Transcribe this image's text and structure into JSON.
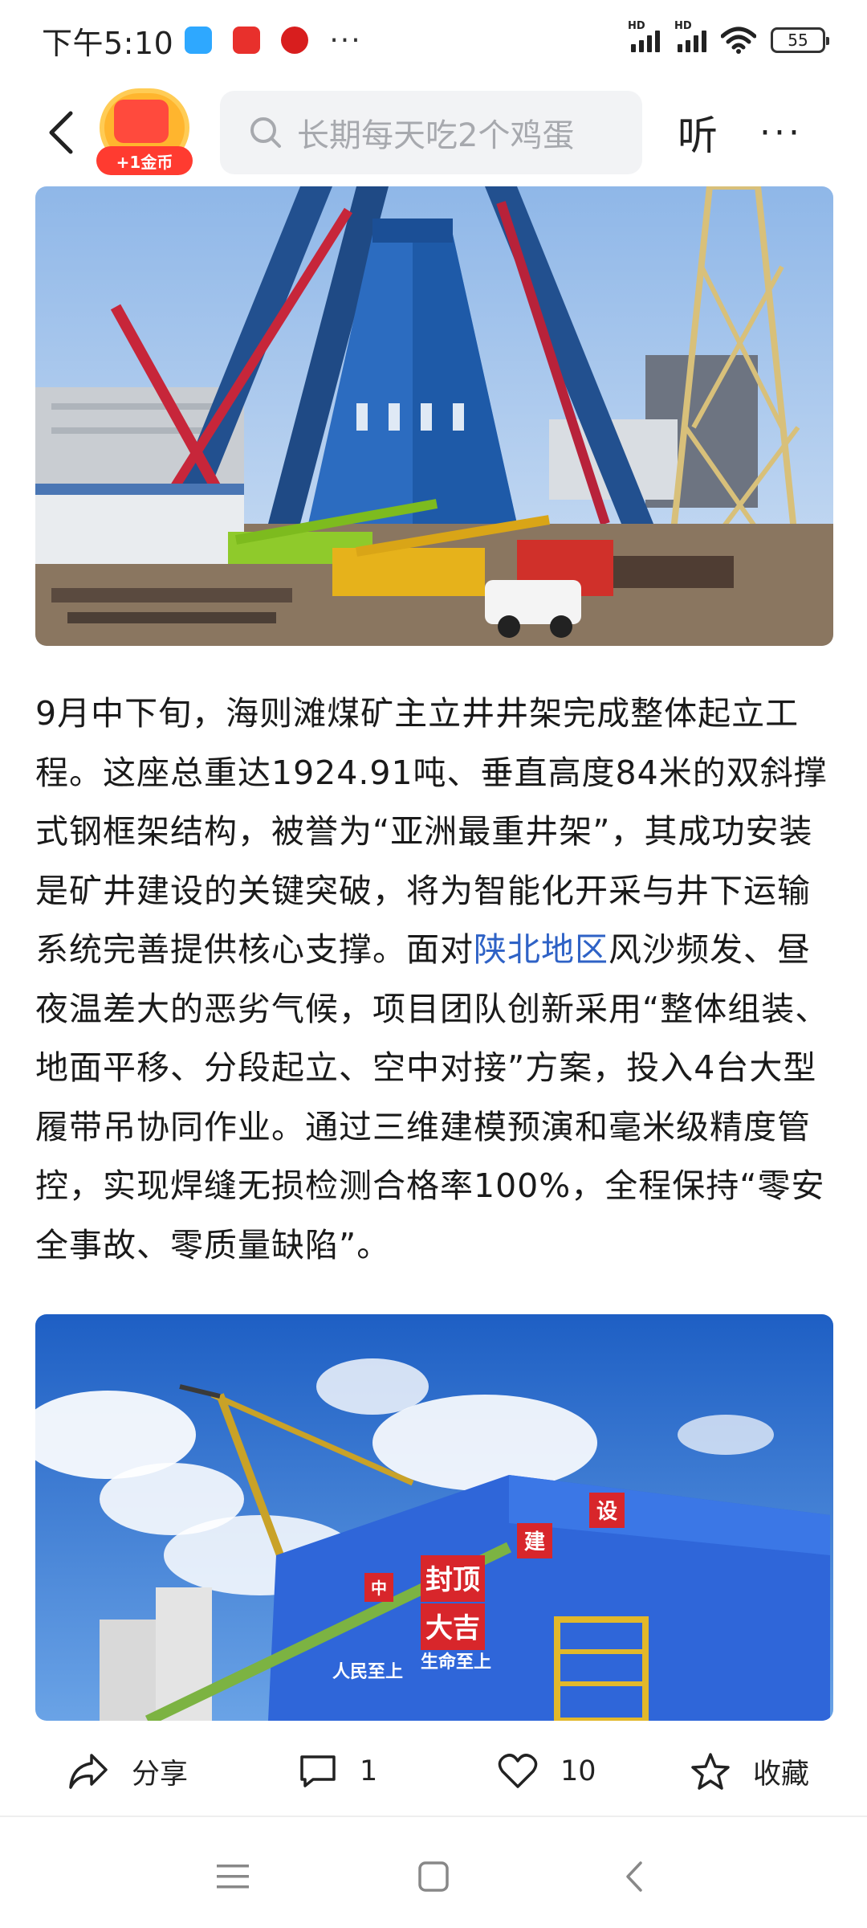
{
  "status_bar": {
    "time": "下午5:10",
    "hd1": "HD",
    "hd2": "HD",
    "battery": "55",
    "more": "···"
  },
  "header": {
    "coin_label": "+1金币",
    "search_placeholder": "长期每天吃2个鸡蛋",
    "listen_label": "听",
    "more_label": "···"
  },
  "article": {
    "paragraph_before_link": "9月中下旬，海则滩煤矿主立井井架完成整体起立工程。这座总重达1924.91吨、垂直高度84米的双斜撑式钢框架结构，被誉为“亚洲最重井架”，其成功安装是矿井建设的关键突破，将为智能化开采与井下运输系统完善提供核心支撑。面对",
    "link_text": "陕北地区",
    "paragraph_after_link": "风沙频发、昼夜温差大的恶劣气候，项目团队创新采用“整体组装、地面平移、分段起立、空中对接”方案，投入4台大型履带吊协同作业。通过三维建模预演和毫米级精度管控，实现焊缝无损检测合格率100%，全程保持“零安全事故、零质量缺陷”。"
  },
  "photo2_signs": {
    "sign_main_1": "封顶",
    "sign_main_2": "大吉",
    "sign_right_1": "建",
    "sign_right_2": "设",
    "sign_left": "中",
    "sign_bottom_1": "人民至上",
    "sign_bottom_2": "生命至上"
  },
  "actions": {
    "share_label": "分享",
    "comment_count": "1",
    "like_count": "10",
    "favorite_label": "收藏"
  },
  "colors": {
    "link": "#2e62c6",
    "coin_red": "#ff3b30",
    "coin_gold": "#ffb52e",
    "search_bg": "#f2f3f5"
  }
}
